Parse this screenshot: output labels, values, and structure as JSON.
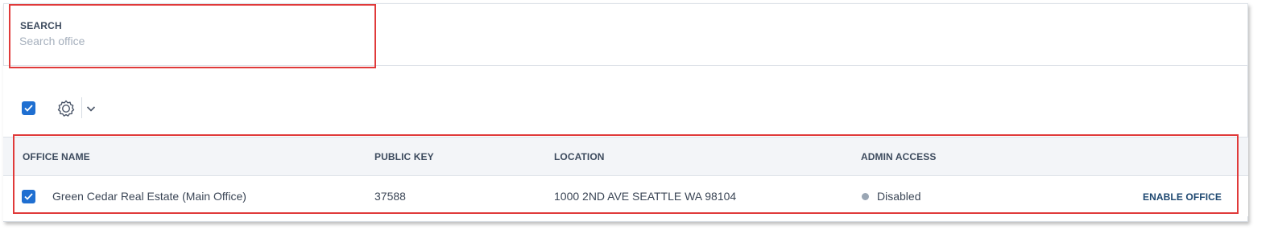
{
  "search": {
    "label": "SEARCH",
    "placeholder": "Search office",
    "value": ""
  },
  "toolbar": {
    "select_all_checked": true,
    "settings_icon": "gear-icon",
    "dropdown_icon": "chevron-down-icon"
  },
  "table": {
    "columns": [
      "OFFICE NAME",
      "PUBLIC KEY",
      "LOCATION",
      "ADMIN ACCESS"
    ],
    "rows": [
      {
        "checked": true,
        "office_name": "Green Cedar Real Estate (Main Office)",
        "public_key": "37588",
        "location": "1000 2ND AVE SEATTLE WA 98104",
        "admin_access": "Disabled",
        "action": "ENABLE OFFICE"
      }
    ]
  },
  "colors": {
    "accent": "#1f6fd1",
    "highlight": "#e03a3a",
    "status_disabled": "#9aa6b4",
    "link": "#1d4770"
  }
}
